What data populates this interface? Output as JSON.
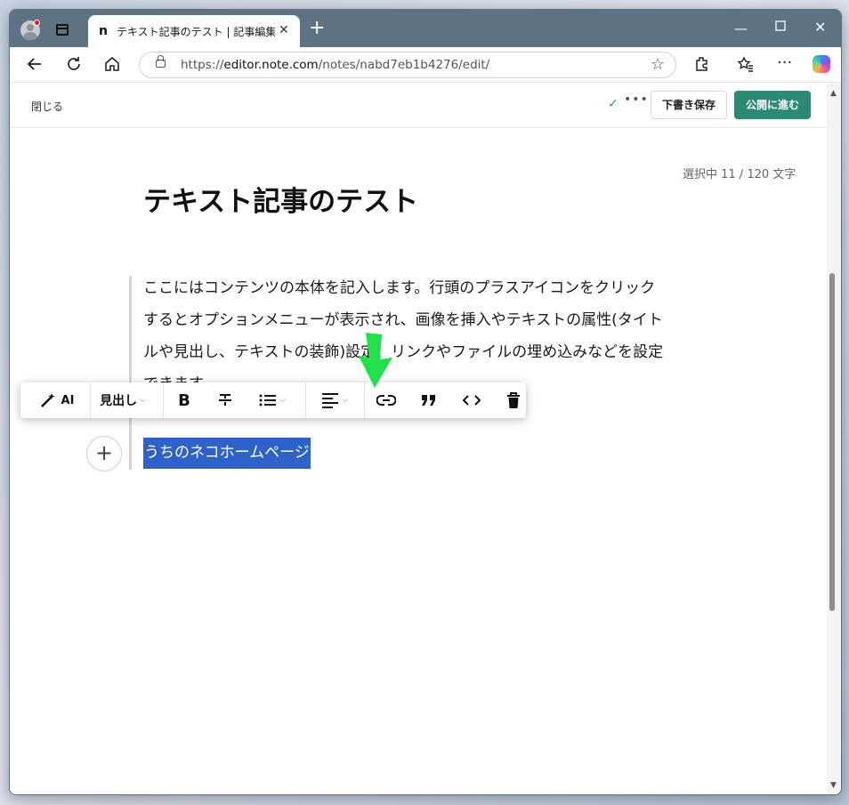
{
  "browser": {
    "tab_title": "テキスト記事のテスト | 記事編集 | note",
    "tab_favicon": "n",
    "new_tab": "+",
    "url_prefix": "https://",
    "url_host": "editor.note.com",
    "url_path": "/notes/nabd7eb1b4276/edit/",
    "icons": [
      "profile-icon",
      "tab-actions-icon",
      "back-icon",
      "refresh-icon",
      "home-icon",
      "lock-icon",
      "favorite-star-icon",
      "extensions-icon",
      "favorites-icon",
      "more-icon",
      "copilot-icon",
      "minimize-icon",
      "maximize-icon",
      "close-icon"
    ]
  },
  "editor_header": {
    "close_label": "閉じる",
    "draft_save_label": "下書き保存",
    "publish_label": "公開に進む",
    "accent_color": "#2a8a74"
  },
  "editor": {
    "selection_count": "選択中 11 / 120 文字",
    "title": "テキスト記事のテスト",
    "body_lines": [
      "ここにはコンテンツの本体を記入します。行頭のプラスアイコンをクリック",
      "するとオプションメニューが表示され、画像を挿入やテキストの属性(タイト",
      "ルや見出し、テキストの装飾)設定、リンクやファイルの埋め込みなどを設定",
      "できます。"
    ],
    "selected_text": "うちのネコホームページ",
    "selection_color": "#2f62c9"
  },
  "format_toolbar": {
    "ai_label": "AI",
    "heading_label": "見出し",
    "items": [
      "ai-icon",
      "heading",
      "bold-icon",
      "strikethrough-icon",
      "list-icon",
      "align-icon",
      "link-icon",
      "quote-icon",
      "code-icon",
      "trash-icon"
    ]
  },
  "annotation": {
    "arrow_color": "#22e04a",
    "points_to": "link-icon"
  }
}
